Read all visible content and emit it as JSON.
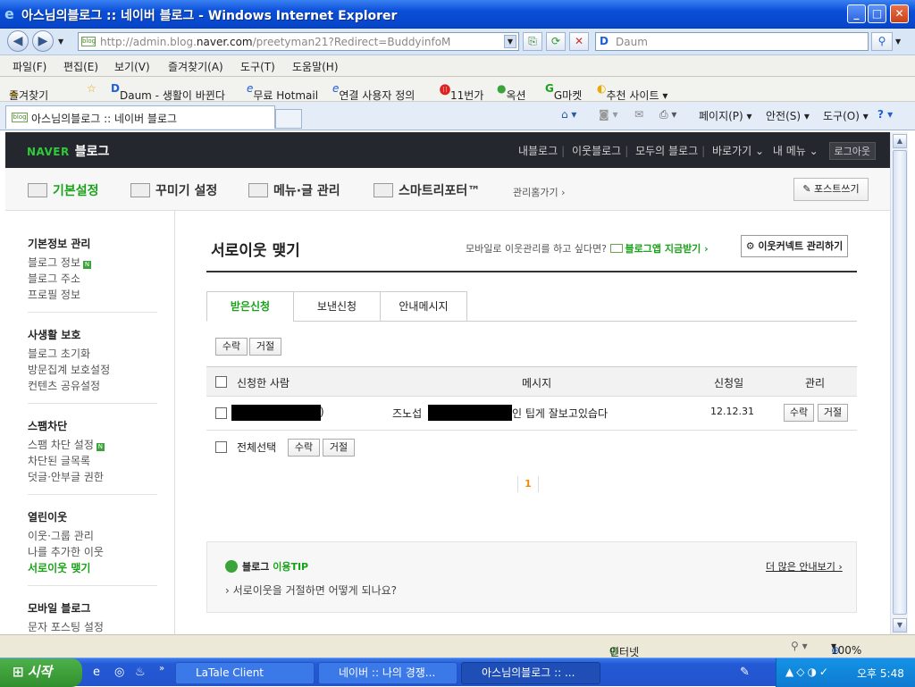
{
  "window": {
    "title": "아스님의블로그 :: 네이버 블로그 - Windows Internet Explorer",
    "min": "_",
    "max": "□",
    "close": "✕"
  },
  "address": {
    "url_prefix": "http://admin.blog.",
    "url_domain": "naver.com",
    "url_suffix": "/preetyman21?Redirect=BuddyinfoM",
    "favicon": "blog",
    "search_placeholder": "Daum"
  },
  "menubar": [
    "파일(F)",
    "편집(E)",
    "보기(V)",
    "즐겨찾기(A)",
    "도구(T)",
    "도움말(H)"
  ],
  "favbar": {
    "favorites": "즐겨찾기",
    "items": [
      "Daum - 생활이 바뀐다",
      "무료 Hotmail",
      "연결 사용자 정의",
      "11번가",
      "옥션",
      "G마켓",
      "추천 사이트 ▾"
    ]
  },
  "tabbar": {
    "tab_title": "아스님의블로그 :: 네이버 블로그",
    "tools": [
      "페이지(P) ▾",
      "안전(S) ▾",
      "도구(O) ▾"
    ]
  },
  "gnb": {
    "brand_naver": "NAVER",
    "brand_blog": "블로그",
    "links": [
      "내블로그",
      "이웃블로그",
      "모두의 블로그",
      "바로가기 ⌄",
      "내 메뉴 ⌄"
    ],
    "logout": "로그아웃"
  },
  "menu2": {
    "items": [
      "기본설정",
      "꾸미기 설정",
      "메뉴·글 관리",
      "스마트리포터™"
    ],
    "sub": "관리홈가기 ›",
    "post_btn": "✎ 포스트쓰기"
  },
  "side": {
    "groups": [
      {
        "title": "기본정보 관리",
        "items": [
          "블로그 정보",
          "블로그 주소",
          "프로필 정보"
        ]
      },
      {
        "title": "사생활 보호",
        "items": [
          "블로그 초기화",
          "방문집계 보호설정",
          "컨텐츠 공유설정"
        ]
      },
      {
        "title": "스팸차단",
        "items": [
          "스팸 차단 설정",
          "차단된 글목록",
          "덧글·안부글 권한"
        ]
      },
      {
        "title": "열린이웃",
        "items": [
          "이웃·그룹 관리",
          "나를 추가한 이웃",
          "서로이웃 맺기"
        ]
      },
      {
        "title": "모바일 블로그",
        "items": [
          "문자 포스팅 설정"
        ]
      }
    ],
    "badge": "N"
  },
  "main": {
    "title": "서로이웃 맺기",
    "promo_text": "모바일로 이웃관리를 하고 싶다면?",
    "promo_link": "블로그앱 지금받기 ›",
    "connect_btn": "⚙ 이웃커넥트 관리하기",
    "tabs": [
      "받은신청",
      "보낸신청",
      "안내메시지"
    ],
    "accept": "수락",
    "reject": "거절",
    "columns": [
      "신청한 사람",
      "메시지",
      "신청일",
      "관리"
    ],
    "row": {
      "name_suffix": ")",
      "msg_prefix": "즈노섭",
      "msg_suffix": "인 팁게 잘보고있습다",
      "date": "12.12.31"
    },
    "select_all": "전체선택",
    "page": "1",
    "tip_title_a": "블로그",
    "tip_title_b": "이용TIP",
    "tip_more": "더 많은 안내보기 ›",
    "tip_question": "› 서로이웃을 거절하면 어떻게 되나요?"
  },
  "status": {
    "zone": "인터넷",
    "zoom": "100%"
  },
  "taskbar": {
    "start": "시작",
    "tasks": [
      "LaTale Client",
      "네이버 :: 나의 경쟁...",
      "아스님의블로그 :: ..."
    ],
    "clock": "오후 5:48"
  },
  "colors": {
    "naver_green": "#1aa31a",
    "gnb_bg": "#24272e",
    "xp_blue": "#0a4fd8"
  }
}
